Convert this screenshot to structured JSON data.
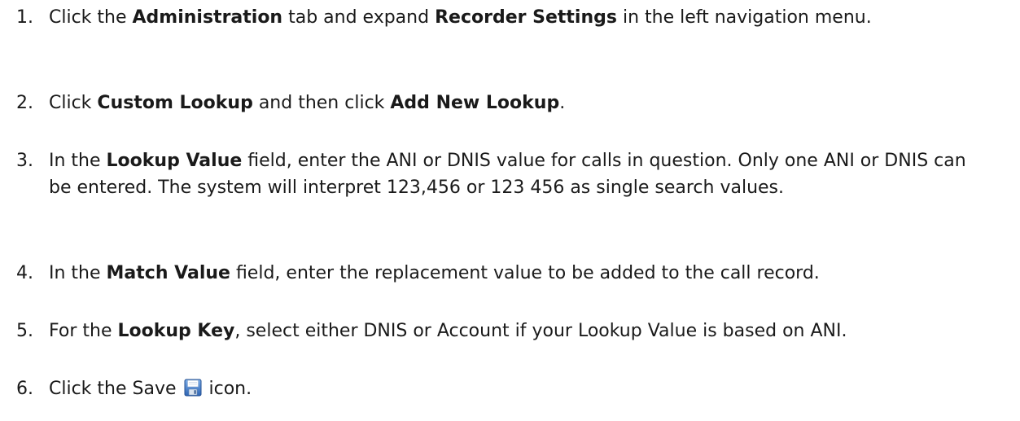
{
  "steps": [
    {
      "num": "1.",
      "parts": [
        "Click the ",
        "Administration",
        " tab and expand ",
        "Recorder Settings",
        " in the left navigation menu."
      ]
    },
    {
      "num": "2.",
      "parts": [
        "Click ",
        "Custom Lookup",
        " and then click ",
        "Add New Lookup",
        "."
      ]
    },
    {
      "num": "3.",
      "parts": [
        "In the ",
        "Lookup Value",
        " field, enter the ANI or DNIS value for calls in question. Only one ANI or DNIS can be entered. The system will interpret 123,456 or 123 456 as single search values."
      ]
    },
    {
      "num": "4.",
      "parts": [
        "In the ",
        "Match Value",
        " field, enter the replacement value to be added to the call record."
      ]
    },
    {
      "num": "5.",
      "parts": [
        "For the ",
        "Lookup Key",
        ", select either DNIS or Account if your Lookup Value is based on ANI."
      ]
    },
    {
      "num": "6.",
      "parts": [
        "Click the Save ",
        "icon."
      ]
    }
  ],
  "icons": {
    "save": "save-floppy-icon"
  },
  "colors": {
    "text": "#1a1a1a",
    "icon_blue": "#3a78c9"
  }
}
